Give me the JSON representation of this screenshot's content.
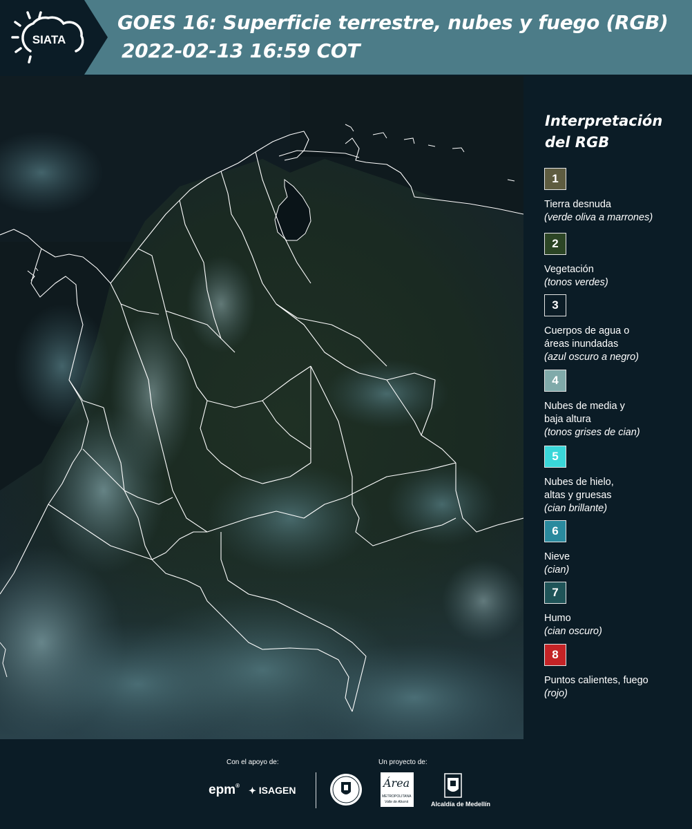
{
  "header": {
    "logo_text": "SIATA",
    "title_line1": "GOES 16: Superficie terrestre, nubes y fuego (RGB)",
    "title_line2": "2022-02-13 16:59 COT",
    "band_color": "#4c7c88"
  },
  "legend": {
    "title_line1": "Interpretación",
    "title_line2": "del RGB",
    "items": [
      {
        "number": "1",
        "color": "#5e5c40",
        "lines": [
          "Tierra desnuda"
        ],
        "note": "(verde oliva a marrones)"
      },
      {
        "number": "2",
        "color": "#2c4525",
        "lines": [
          "Vegetación"
        ],
        "note": "(tonos verdes)"
      },
      {
        "number": "3",
        "color": "#0b1c26",
        "lines": [
          "Cuerpos de agua o",
          "áreas inundadas"
        ],
        "note": "(azul oscuro a negro)"
      },
      {
        "number": "4",
        "color": "#80aaaa",
        "lines": [
          "Nubes de media y",
          "baja altura"
        ],
        "note": "(tonos grises de cian)"
      },
      {
        "number": "5",
        "color": "#3ad7d9",
        "lines": [
          "Nubes de hielo,",
          "altas y gruesas"
        ],
        "note": "(cian brillante)"
      },
      {
        "number": "6",
        "color": "#2a8a9e",
        "lines": [
          "Nieve"
        ],
        "note": "(cian)"
      },
      {
        "number": "7",
        "color": "#1f5458",
        "lines": [
          "Humo"
        ],
        "note": "(cian oscuro)"
      },
      {
        "number": "8",
        "color": "#c42326",
        "lines": [
          "Puntos calientes, fuego"
        ],
        "note": "(rojo)"
      }
    ]
  },
  "footer": {
    "support_label": "Con el apoyo de:",
    "project_label": "Un proyecto de:",
    "sponsor_epm": "epm",
    "sponsor_isagen": "ISAGEN",
    "area_logo_text": "Área",
    "area_logo_sub": "METROPOLITANA",
    "area_logo_sub2": "Valle de Aburrá",
    "alcaldia": "Alcaldía de Medellín"
  }
}
